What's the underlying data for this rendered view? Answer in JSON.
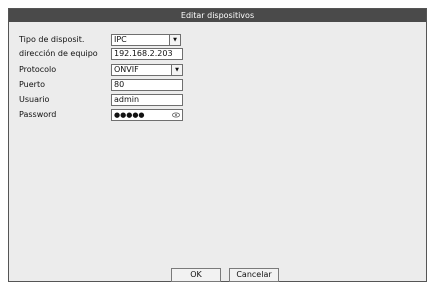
{
  "dialog": {
    "title": "Editar dispositivos",
    "fields": {
      "device_type": {
        "label": "Tipo de disposit.",
        "value": "IPC"
      },
      "address": {
        "label": "dirección de equipo",
        "value": "192.168.2.203"
      },
      "protocol": {
        "label": "Protocolo",
        "value": "ONVIF"
      },
      "port": {
        "label": "Puerto",
        "value": "80"
      },
      "user": {
        "label": "Usuario",
        "value": "admin"
      },
      "password": {
        "label": "Password",
        "value": "●●●●●"
      }
    },
    "buttons": {
      "ok": "OK",
      "cancel": "Cancelar"
    }
  }
}
